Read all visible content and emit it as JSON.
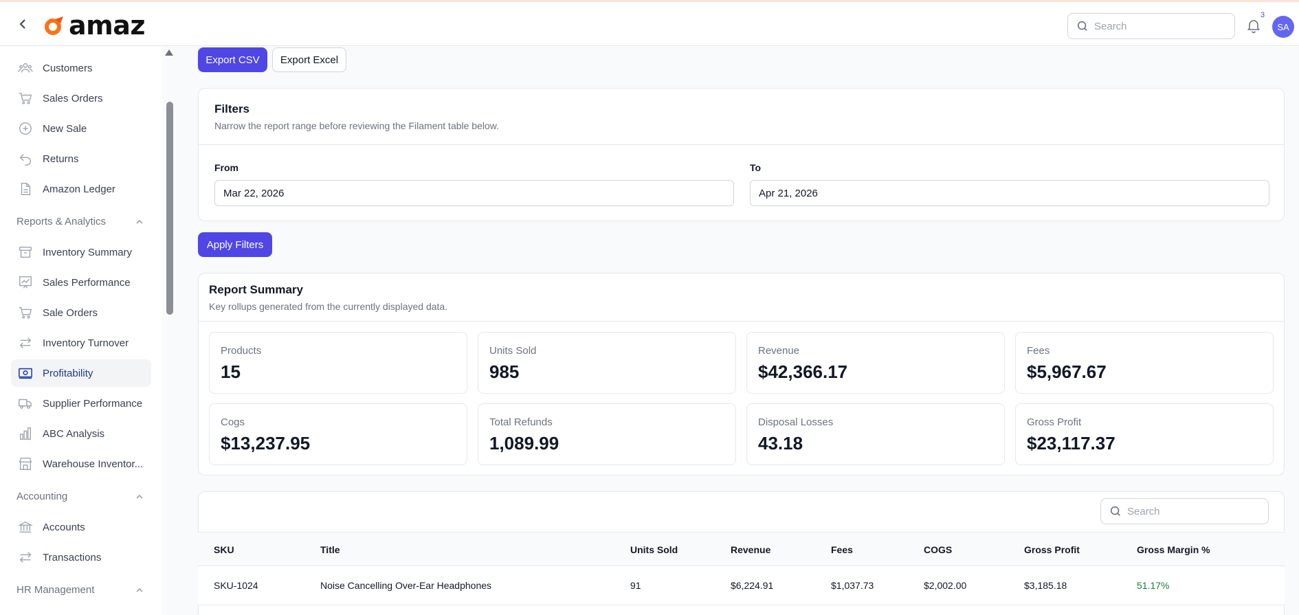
{
  "header": {
    "logo_text": "amaz",
    "search_placeholder": "Search",
    "notification_count": "3",
    "avatar_initials": "SA"
  },
  "sidebar": {
    "items": [
      {
        "label": "Customers",
        "icon": "users-icon"
      },
      {
        "label": "Sales Orders",
        "icon": "cart-icon"
      },
      {
        "label": "New Sale",
        "icon": "plus-circle-icon"
      },
      {
        "label": "Returns",
        "icon": "return-arrow-icon"
      },
      {
        "label": "Amazon Ledger",
        "icon": "document-icon"
      }
    ],
    "groups": [
      {
        "label": "Reports & Analytics",
        "expanded": true
      },
      {
        "label": "Accounting",
        "expanded": true
      },
      {
        "label": "HR Management",
        "expanded": true
      }
    ],
    "reports_items": [
      {
        "label": "Inventory Summary",
        "icon": "archive-box-icon"
      },
      {
        "label": "Sales Performance",
        "icon": "chart-presentation-icon"
      },
      {
        "label": "Sale Orders",
        "icon": "cart-icon"
      },
      {
        "label": "Inventory Turnover",
        "icon": "arrows-exchange-icon"
      },
      {
        "label": "Profitability",
        "icon": "banknote-icon",
        "active": true
      },
      {
        "label": "Supplier Performance",
        "icon": "truck-icon"
      },
      {
        "label": "ABC Analysis",
        "icon": "bar-chart-icon"
      },
      {
        "label": "Warehouse Inventor...",
        "icon": "building-storefront-icon"
      }
    ],
    "accounting_items": [
      {
        "label": "Accounts",
        "icon": "bank-icon"
      },
      {
        "label": "Transactions",
        "icon": "arrows-exchange-icon"
      }
    ]
  },
  "actions": {
    "export_csv": "Export CSV",
    "export_excel": "Export Excel",
    "apply_filters": "Apply Filters"
  },
  "filters": {
    "title": "Filters",
    "subtitle": "Narrow the report range before reviewing the Filament table below.",
    "from_label": "From",
    "from_value": "Mar 22, 2026",
    "to_label": "To",
    "to_value": "Apr 21, 2026"
  },
  "summary": {
    "title": "Report Summary",
    "subtitle": "Key rollups generated from the currently displayed data.",
    "stats": [
      {
        "label": "Products",
        "value": "15"
      },
      {
        "label": "Units Sold",
        "value": "985"
      },
      {
        "label": "Revenue",
        "value": "$42,366.17"
      },
      {
        "label": "Fees",
        "value": "$5,967.67"
      },
      {
        "label": "Cogs",
        "value": "$13,237.95"
      },
      {
        "label": "Total Refunds",
        "value": "1,089.99"
      },
      {
        "label": "Disposal Losses",
        "value": "43.18"
      },
      {
        "label": "Gross Profit",
        "value": "$23,117.37"
      }
    ]
  },
  "table": {
    "search_placeholder": "Search",
    "columns": [
      "SKU",
      "Title",
      "Units Sold",
      "Revenue",
      "Fees",
      "COGS",
      "Gross Profit",
      "Gross Margin %"
    ],
    "rows": [
      [
        "SKU-1024",
        "Noise Cancelling Over-Ear Headphones",
        "91",
        "$6,224.91",
        "$1,037.73",
        "$2,002.00",
        "$3,185.18",
        "51.17%"
      ]
    ]
  },
  "colors": {
    "primary": "#4f46e5",
    "margin_positive": "#15803d",
    "active_nav_text": "#1e3a8a"
  }
}
